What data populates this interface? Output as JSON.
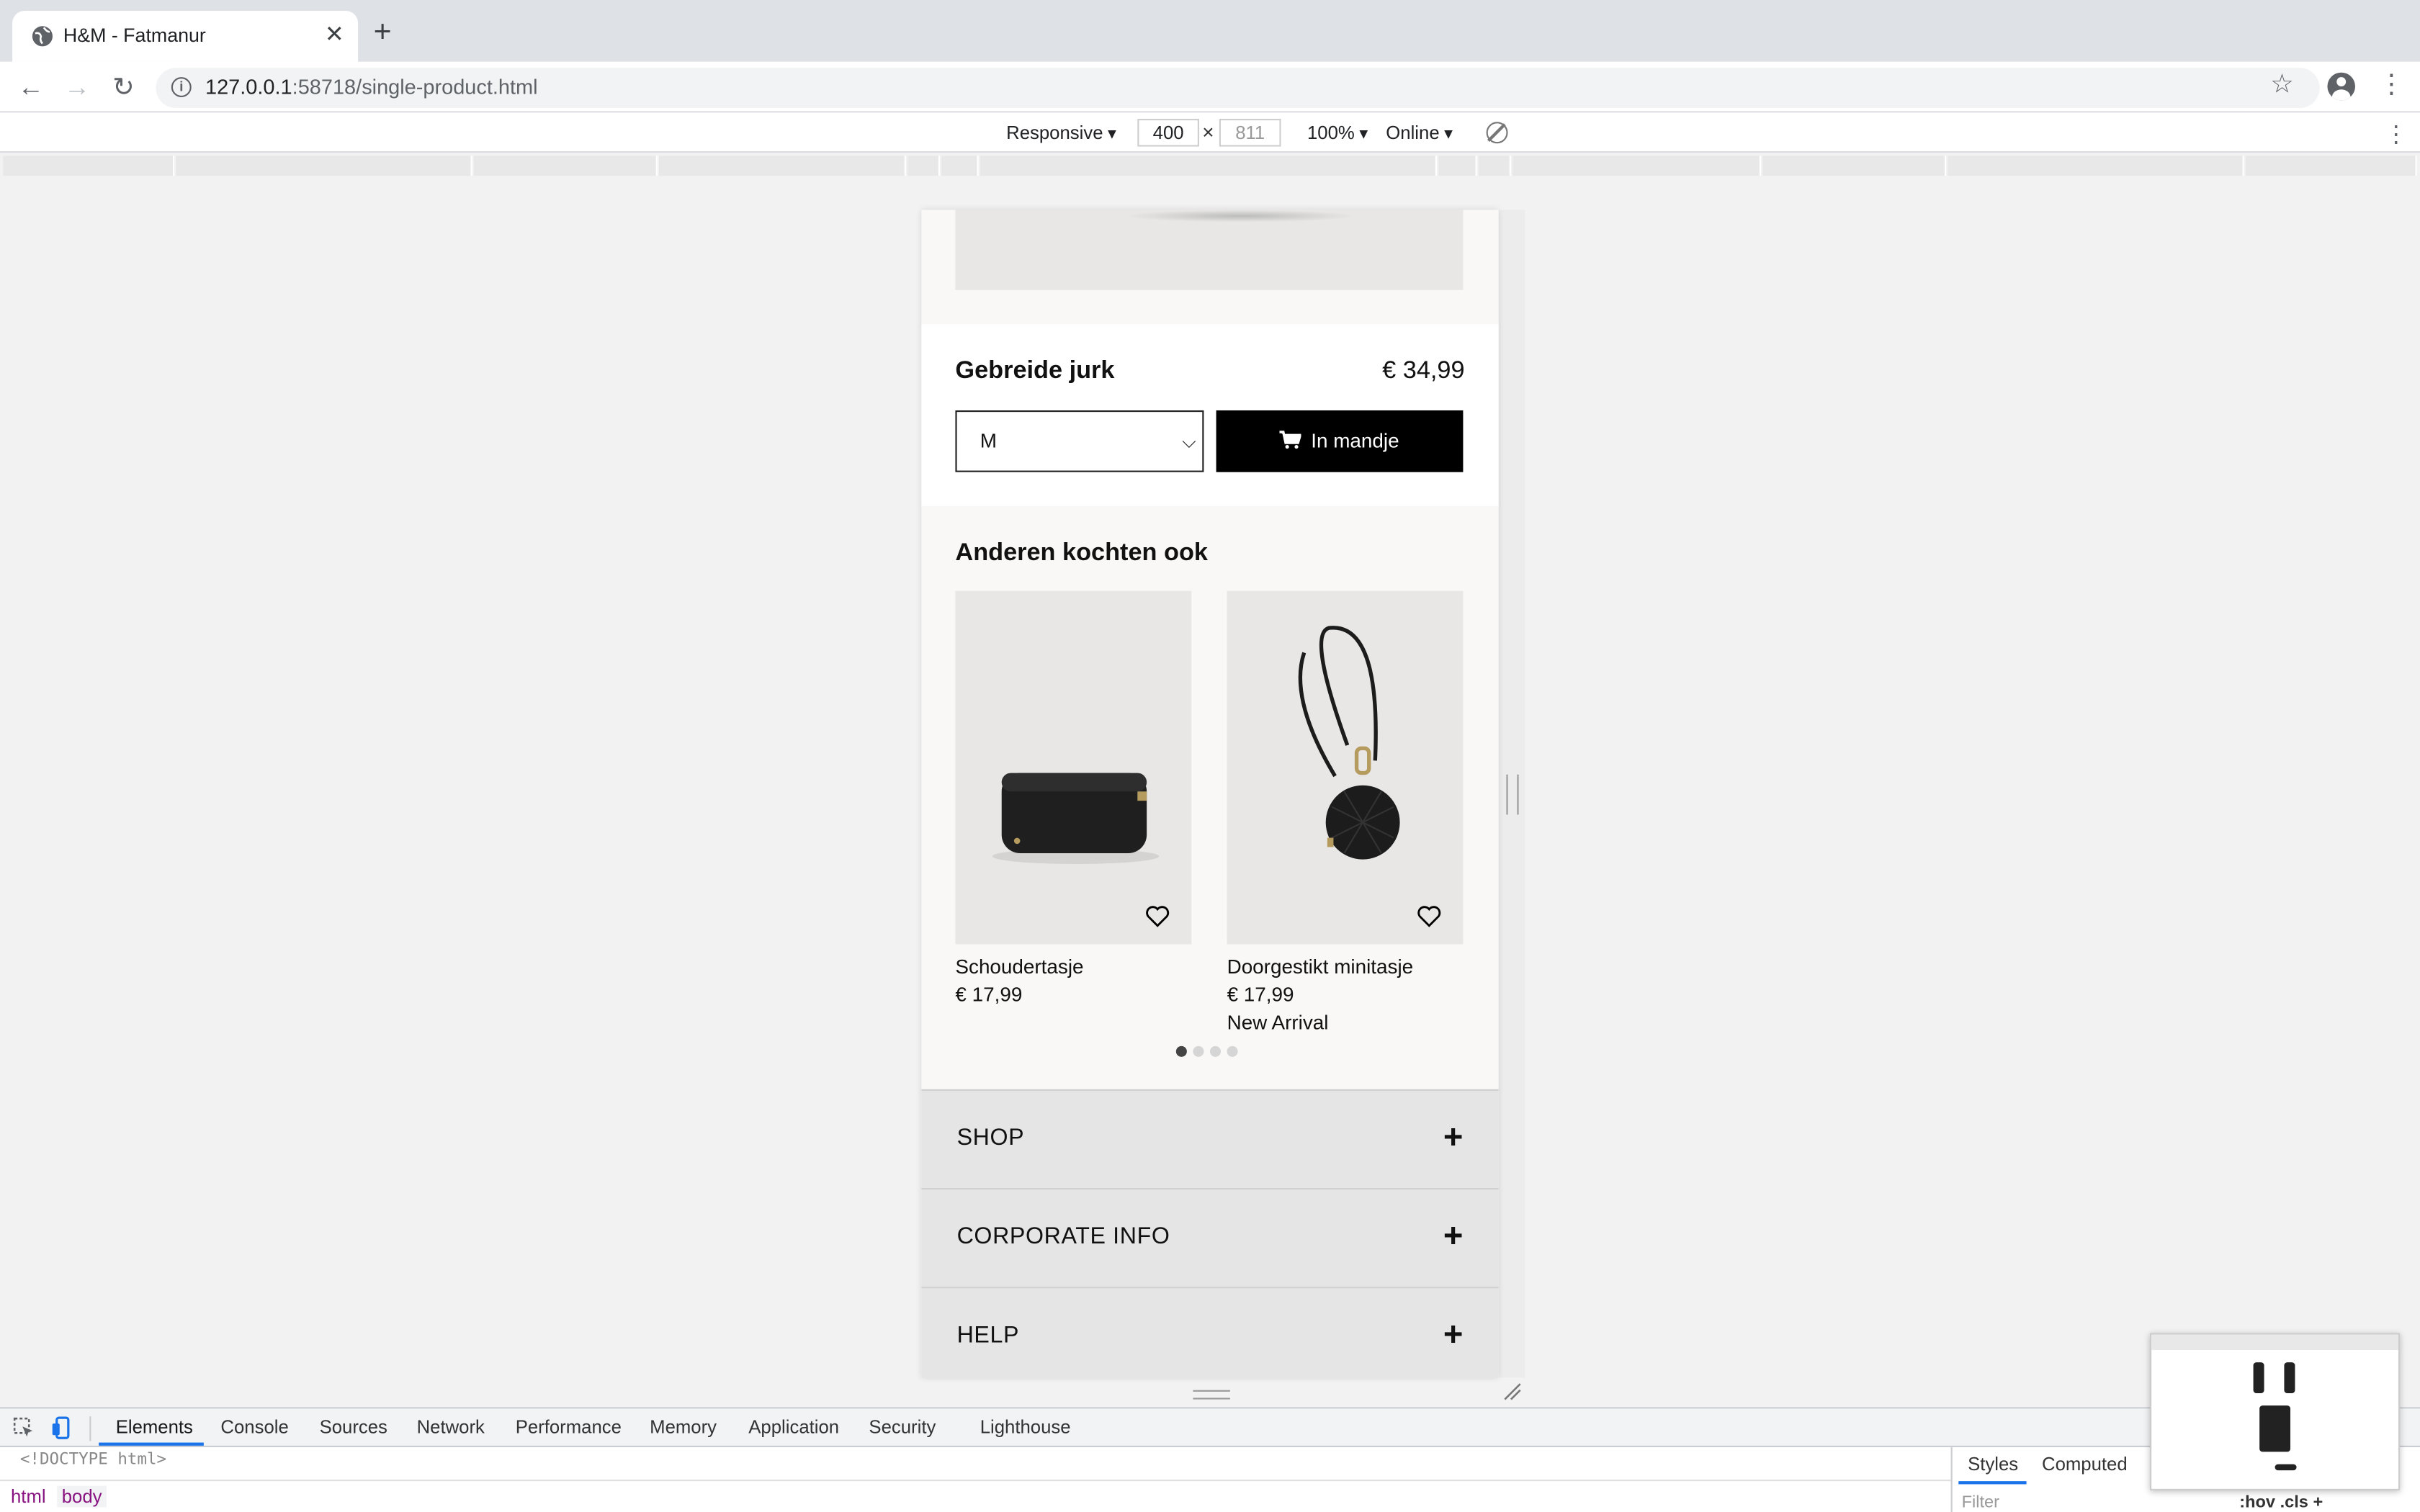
{
  "browser": {
    "tab_title": "H&M - Fatmanur",
    "url_host": "127.0.0.1",
    "url_rest": ":58718/single-product.html"
  },
  "device_toolbar": {
    "mode": "Responsive",
    "width": "400",
    "height": "811",
    "zoom": "100%",
    "network": "Online"
  },
  "product": {
    "name": "Gebreide jurk",
    "price": "€ 34,99",
    "size": "M",
    "cart_label": "In mandje"
  },
  "also_bought": {
    "title": "Anderen kochten ook",
    "items": [
      {
        "name": "Schoudertasje",
        "price": "€ 17,99",
        "badge": ""
      },
      {
        "name": "Doorgestikt minitasje",
        "price": "€ 17,99",
        "badge": "New Arrival"
      }
    ],
    "carousel_pages": 4,
    "carousel_active": 1
  },
  "footer": {
    "sections": [
      "SHOP",
      "CORPORATE INFO",
      "HELP"
    ]
  },
  "devtools": {
    "tabs": [
      "Elements",
      "Console",
      "Sources",
      "Network",
      "Performance",
      "Memory",
      "Application",
      "Security",
      "Lighthouse"
    ],
    "active_tab": "Elements",
    "dom_line": "<!DOCTYPE html>",
    "breadcrumbs": [
      "html",
      "body"
    ],
    "side_tabs": [
      "Styles",
      "Computed"
    ],
    "filter_placeholder": "Filter",
    "filter_actions": ":hov  .cls  +"
  },
  "colors": {
    "accent": "#1a73e8",
    "button": "#000000",
    "footer_bg": "#e5e5e5"
  }
}
